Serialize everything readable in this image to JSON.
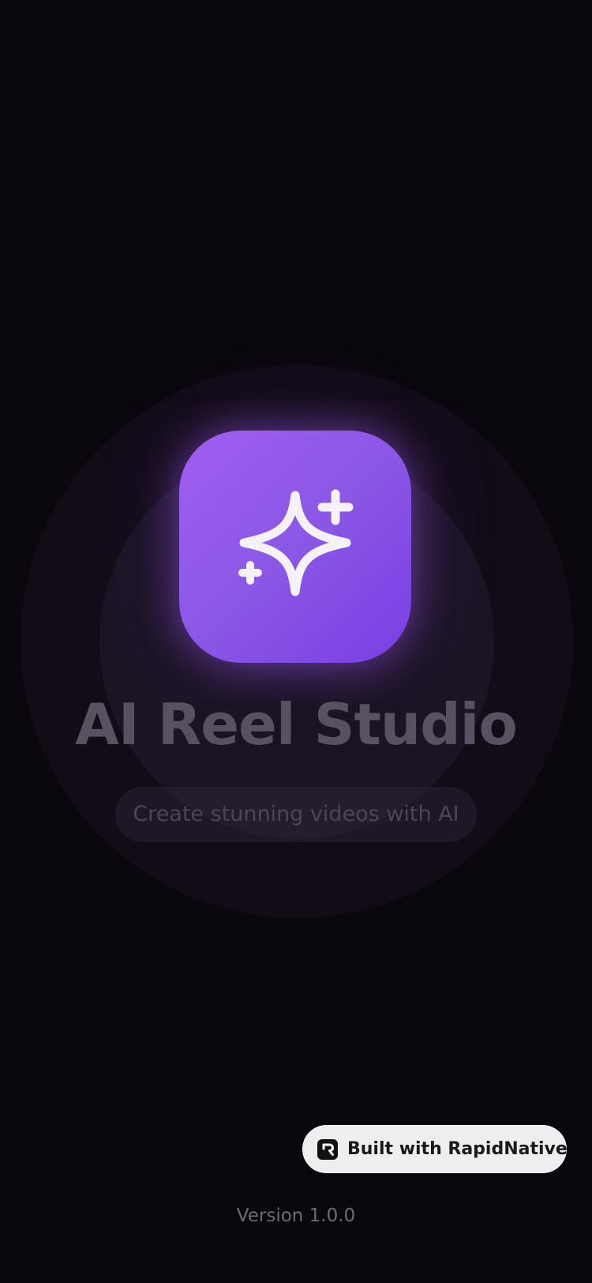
{
  "app": {
    "title": "AI Reel Studio",
    "tagline": "Create stunning videos with AI",
    "icon": "sparkles-icon"
  },
  "badge": {
    "label": "Built with RapidNative",
    "icon": "rapidnative-logo-icon"
  },
  "footer": {
    "version": "Version 1.0.0"
  },
  "colors": {
    "background": "#0b070e",
    "icon_gradient_start": "#a25ef0",
    "icon_gradient_end": "#7a3ee3",
    "title": "#5a5160",
    "badge_background": "#eeeef0"
  }
}
